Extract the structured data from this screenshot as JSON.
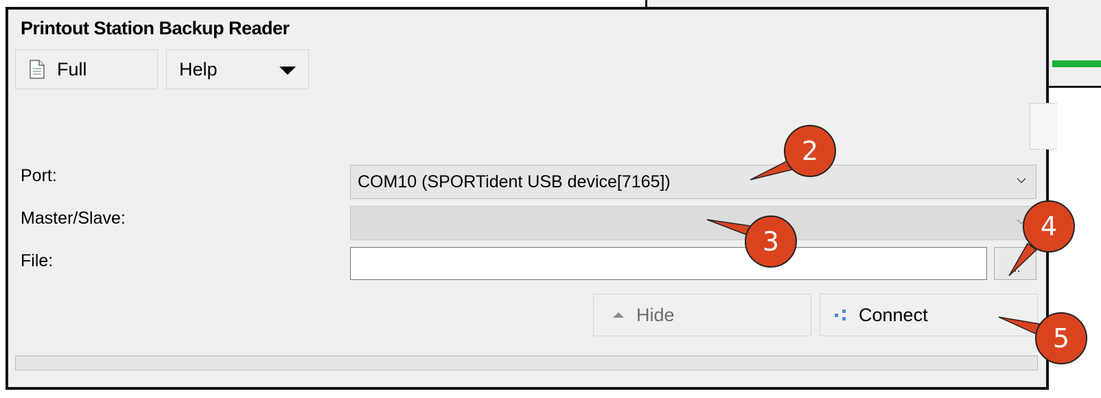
{
  "window": {
    "title": "Printout Station Backup Reader"
  },
  "toolbar": {
    "full_label": "Full",
    "help_label": "Help"
  },
  "form": {
    "port_label": "Port:",
    "port_value": "COM10 (SPORTident USB device[7165])",
    "master_slave_label": "Master/Slave:",
    "master_slave_value": "",
    "file_label": "File:",
    "file_value": "",
    "browse_label": "..."
  },
  "actions": {
    "hide_label": "Hide",
    "connect_label": "Connect"
  },
  "progress": {
    "value": 0
  },
  "callouts": [
    "2",
    "3",
    "4",
    "5"
  ],
  "colors": {
    "callout": "#d9441f",
    "dialog_bg": "#f0f0f0",
    "accent_green": "#19b23b"
  }
}
